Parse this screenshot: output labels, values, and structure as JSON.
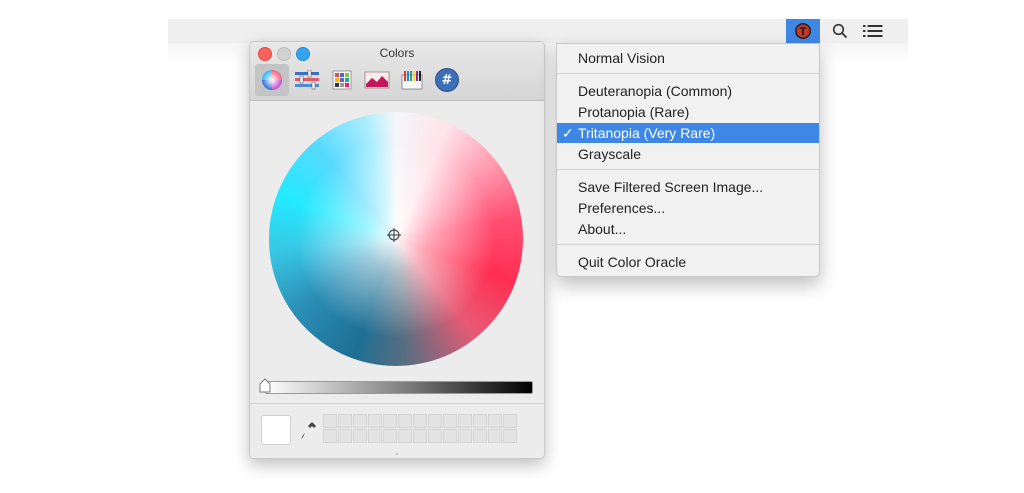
{
  "menubar": {
    "app_icon_letter": "T",
    "icons": [
      "color-oracle-app-icon",
      "search-icon",
      "list-icon"
    ],
    "accent_color": "#3f87e5"
  },
  "colors_panel": {
    "title": "Colors",
    "toolbar_tabs": [
      "color-wheel-icon",
      "color-sliders-icon",
      "color-palettes-icon",
      "image-palettes-icon",
      "crayons-icon",
      "hex-icon"
    ],
    "hex_tab_glyph": "#",
    "selected_tab": "color-wheel",
    "brightness_slider_value": 0,
    "selected_color": "#ffffff",
    "swatch_grid": {
      "rows": 2,
      "columns": 13
    }
  },
  "menu": {
    "items": [
      {
        "label": "Normal Vision"
      },
      {
        "label": "Deuteranopia (Common)"
      },
      {
        "label": "Protanopia (Rare)"
      },
      {
        "label": "Tritanopia (Very Rare)",
        "checked": true,
        "highlighted": true
      },
      {
        "label": "Grayscale"
      },
      {
        "label": "Save Filtered Screen Image..."
      },
      {
        "label": "Preferences..."
      },
      {
        "label": "About..."
      },
      {
        "label": "Quit Color Oracle"
      }
    ],
    "check_mark": "✓",
    "highlight_color": "#3f87e5"
  }
}
